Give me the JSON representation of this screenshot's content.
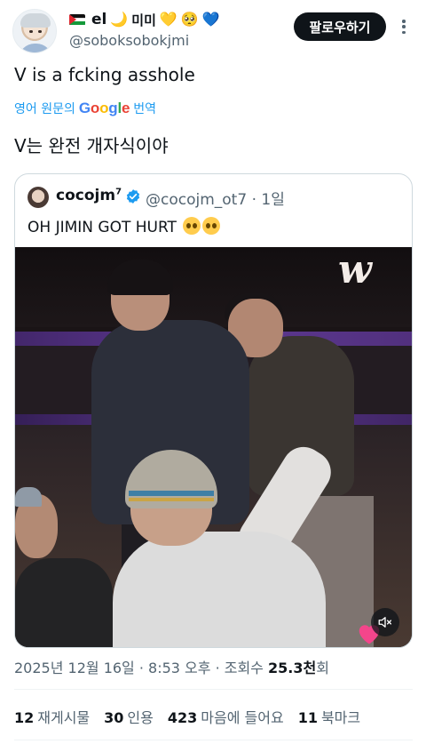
{
  "author": {
    "name": "el",
    "name_emojis": [
      "🌙",
      "미미",
      "💛",
      "🥺",
      "💙"
    ],
    "handle": "@soboksobokjmi"
  },
  "follow_button": {
    "label": "팔로우하기"
  },
  "tweet": {
    "text": "V is a fcking asshole",
    "translate_prefix": "영어 원문의",
    "translate_brand": "Google",
    "translate_suffix": "번역",
    "translated_text": "V는 완전 개자식이야"
  },
  "quote": {
    "name": "cocojm",
    "name_sup": "7",
    "handle_time": "@cocojm_ot7 · 1일",
    "text": "OH JIMIN GOT HURT",
    "video_watermark": "w"
  },
  "meta": {
    "date_time": "2025년 12월 16일 · 8:53 오후 · 조회수 ",
    "views_value": "25.3천",
    "views_suffix": "회"
  },
  "stats": {
    "retweets_count": "12",
    "retweets_label": "재게시물",
    "quotes_count": "30",
    "quotes_label": "인용",
    "likes_count": "423",
    "likes_label": "마음에 들어요",
    "bookmarks_count": "11",
    "bookmarks_label": "북마크"
  },
  "colors": {
    "accent": "#1d9bf0",
    "text": "#0f1419",
    "muted": "#536471",
    "border": "#cfd9de"
  },
  "icons": [
    "more-icon",
    "verified-icon",
    "mute-icon",
    "heart-icon"
  ]
}
